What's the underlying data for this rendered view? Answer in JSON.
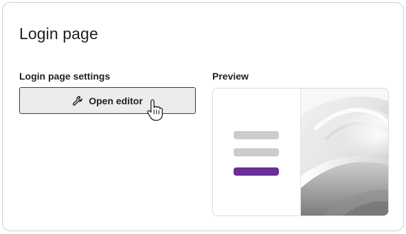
{
  "header": {
    "title": "Login page"
  },
  "settings": {
    "label": "Login page settings",
    "open_editor_label": "Open editor",
    "open_editor_icon": "wrench-icon"
  },
  "preview": {
    "label": "Preview",
    "bar_colors": [
      "#cccccc",
      "#cccccc",
      "#6b2f99"
    ],
    "background_image": "abstract-gray-waves"
  },
  "cursor": {
    "icon": "hand-pointer-icon"
  }
}
